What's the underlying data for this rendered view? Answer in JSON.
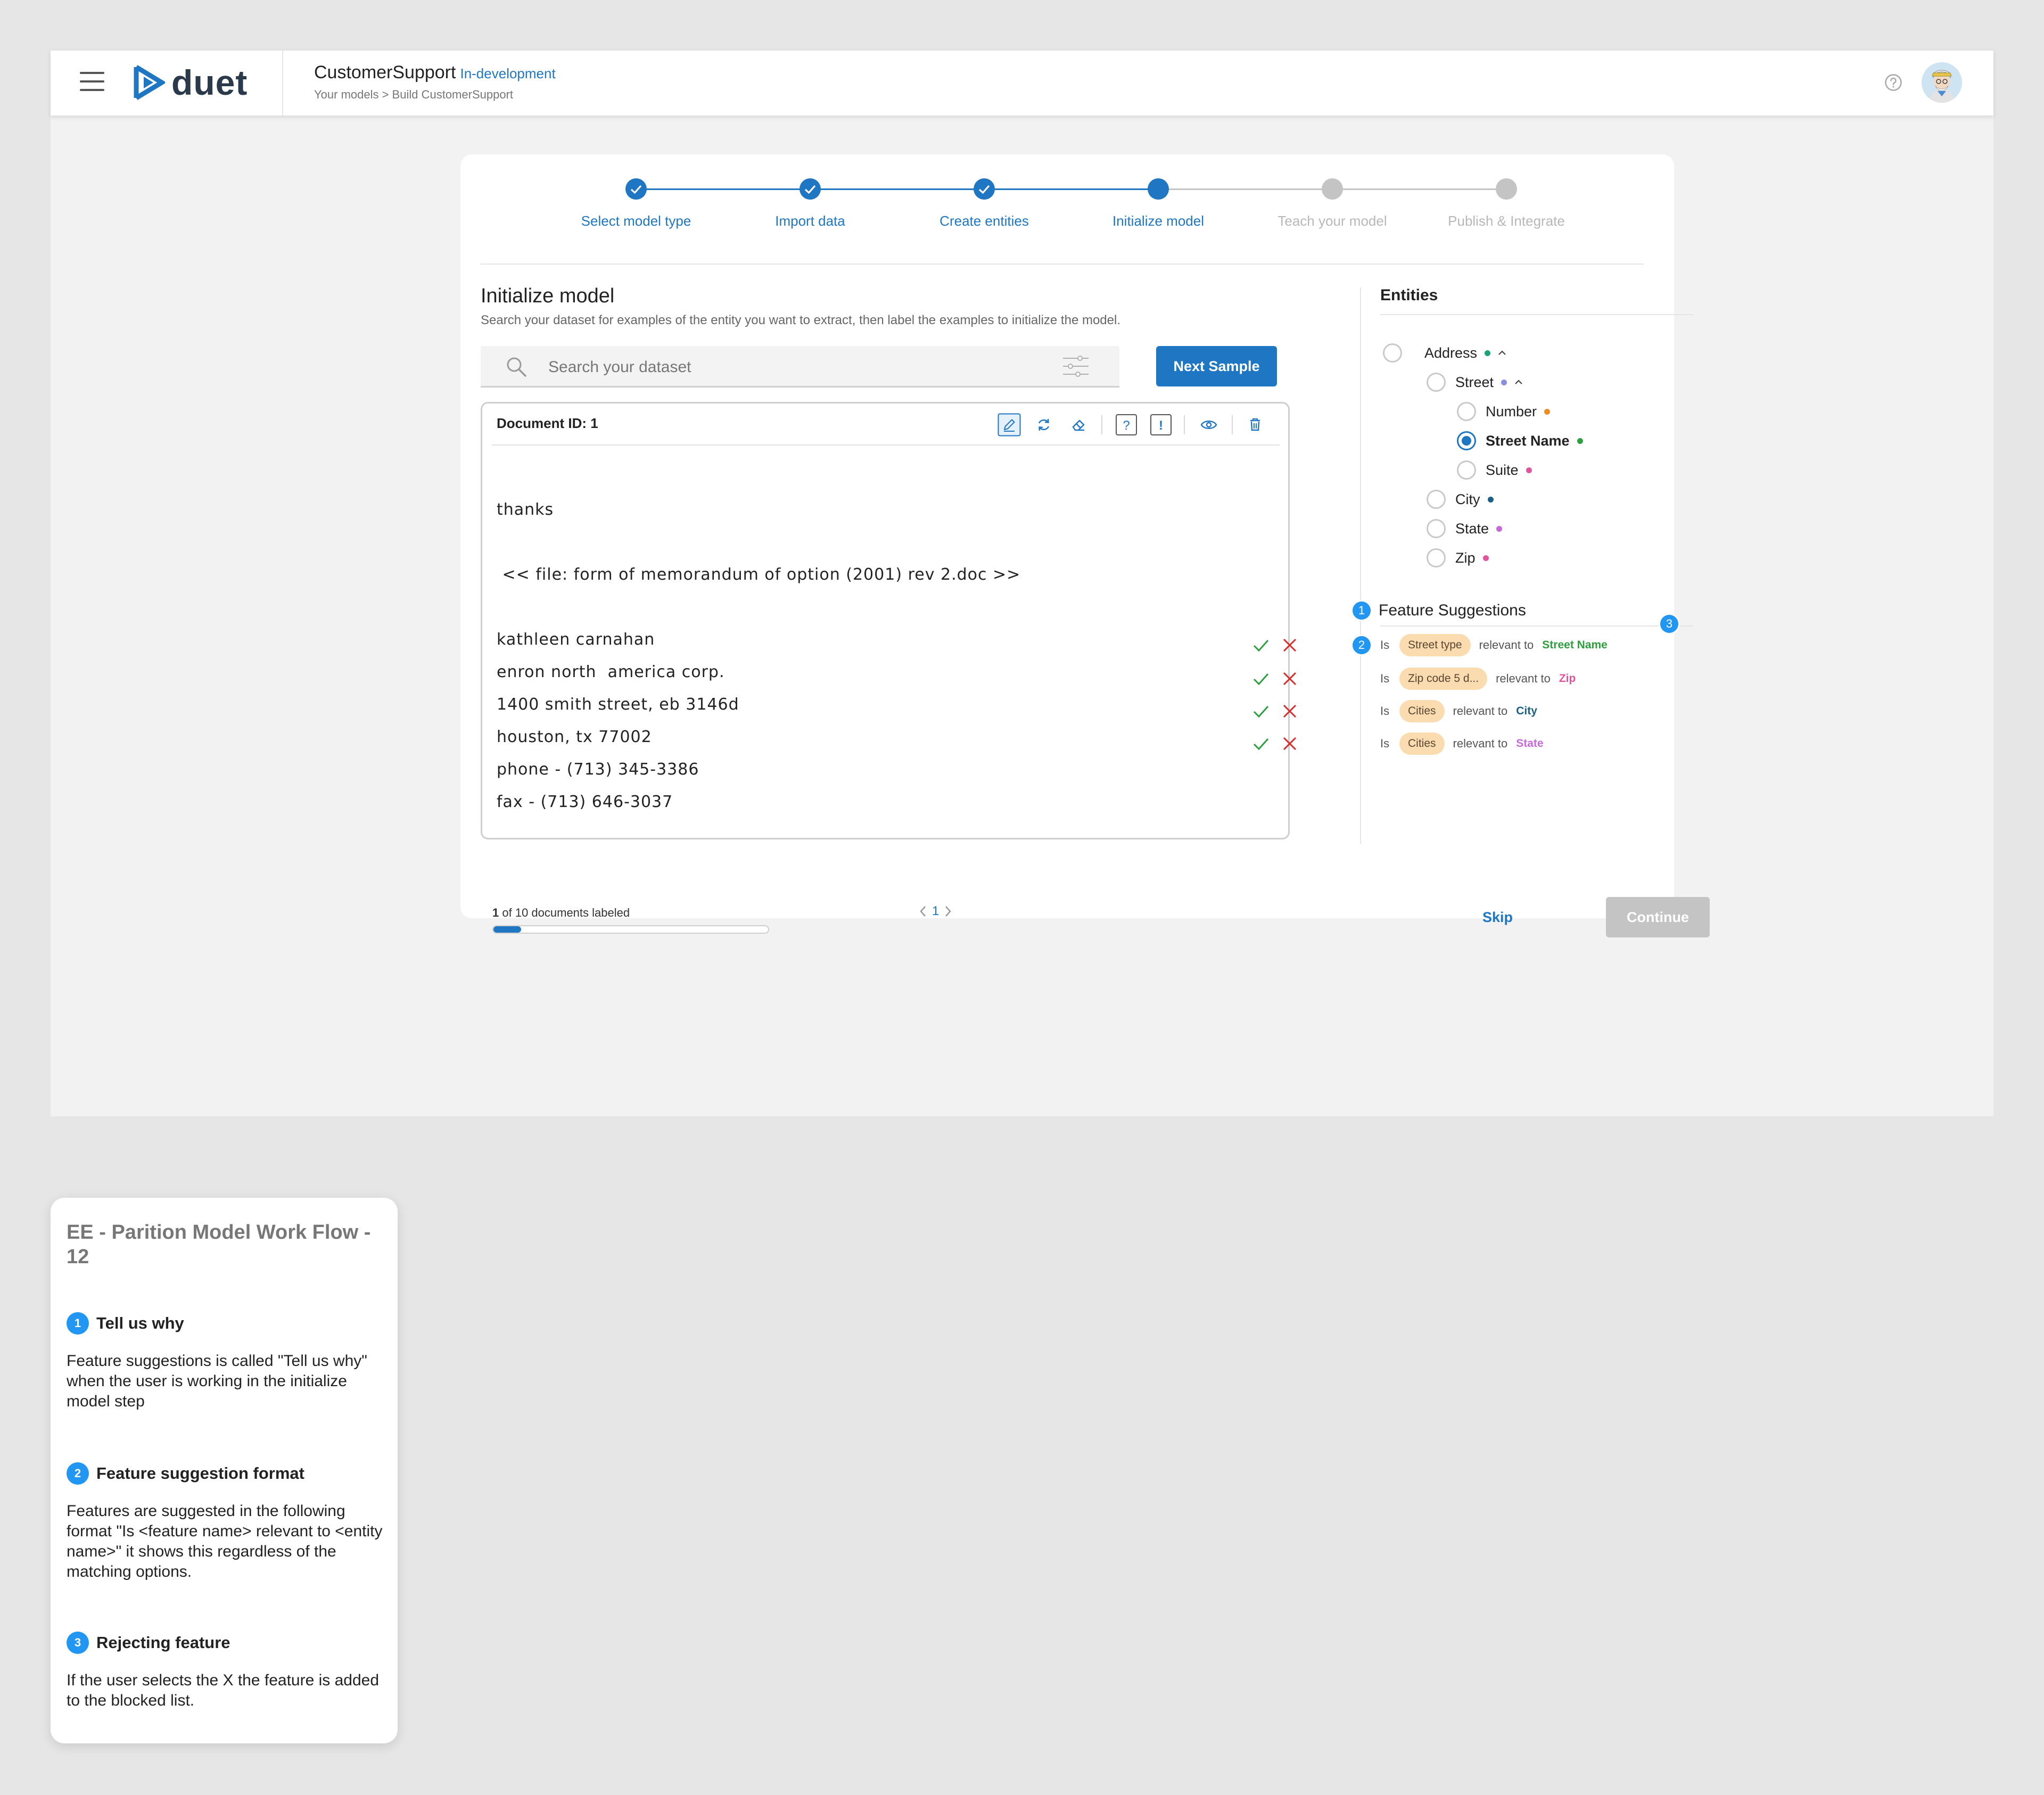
{
  "header": {
    "logo_text": "duet",
    "app_name": "CustomerSupport",
    "app_status": "In-development",
    "breadcrumb": "Your models > Build CustomerSupport"
  },
  "steps": [
    {
      "label": "Select model type",
      "state": "done"
    },
    {
      "label": "Import data",
      "state": "done"
    },
    {
      "label": "Create entities",
      "state": "done"
    },
    {
      "label": "Initialize model",
      "state": "current"
    },
    {
      "label": "Teach your model",
      "state": "todo"
    },
    {
      "label": "Publish & Integrate",
      "state": "todo"
    }
  ],
  "main": {
    "title": "Initialize model",
    "description": "Search your dataset for examples of the entity you want to extract, then label the examples to initialize the model.",
    "search_placeholder": "Search your dataset",
    "next_sample_label": "Next Sample"
  },
  "document": {
    "id_label": "Document ID: 1",
    "lines": [
      "thanks",
      " << file: form of memorandum of option (2001) rev 2.doc >>",
      "kathleen carnahan",
      "enron north  america corp.",
      "1400 smith street, eb 3146d",
      "houston, tx 77002",
      "phone - (713) 345-3386",
      "fax - (713) 646-3037"
    ]
  },
  "progress": {
    "labeled": "1",
    "rest": "of 10 documents labeled",
    "fraction": 0.1,
    "page": "1"
  },
  "entities": {
    "title": "Entities",
    "items": [
      {
        "label": "Address",
        "color": "#1aa37a",
        "checked": false
      },
      {
        "label": "Street",
        "color": "#8c8ce0",
        "checked": false
      },
      {
        "label": "Number",
        "color": "#f08a24",
        "checked": false
      },
      {
        "label": "Street Name",
        "color": "#2e9e3e",
        "checked": true
      },
      {
        "label": "Suite",
        "color": "#e0569e",
        "checked": false
      },
      {
        "label": "City",
        "color": "#1c5f86",
        "checked": false
      },
      {
        "label": "State",
        "color": "#c56ad8",
        "checked": false
      },
      {
        "label": "Zip",
        "color": "#e0569e",
        "checked": false
      }
    ]
  },
  "feature_suggestions": {
    "title": "Feature Suggestions",
    "is_word": "Is",
    "relevant_word": "relevant to",
    "items": [
      {
        "feature": "Street type",
        "entity": "Street Name",
        "entity_color": "#2e9e3e"
      },
      {
        "feature": "Zip code 5 d...",
        "entity": "Zip",
        "entity_color": "#e0569e"
      },
      {
        "feature": "Cities",
        "entity": "City",
        "entity_color": "#1c5f86"
      },
      {
        "feature": "Cities",
        "entity": "State",
        "entity_color": "#c56ad8"
      }
    ],
    "badges": [
      "1",
      "2",
      "3"
    ]
  },
  "footer": {
    "skip_label": "Skip",
    "continue_label": "Continue"
  },
  "note": {
    "title": "EE - Parition Model Work Flow - 12",
    "sections": [
      {
        "num": "1",
        "heading": "Tell us why",
        "body": "Feature suggestions is called \"Tell us why\" when the user is working in the initialize model step"
      },
      {
        "num": "2",
        "heading": "Feature suggestion format",
        "body": "Features are suggested in the following format \"Is <feature name> relevant to <entity name>\" it shows this regardless of the matching options."
      },
      {
        "num": "3",
        "heading": "Rejecting feature",
        "body": "If the user selects the X the feature is added to the blocked list."
      }
    ]
  },
  "colors": {
    "accent": "#1f76c2",
    "badge": "#2196f3",
    "chip_bg": "#fbdcb1",
    "accept": "#2e9e3e",
    "reject": "#d32f2f",
    "disabled": "#c4c4c4"
  }
}
